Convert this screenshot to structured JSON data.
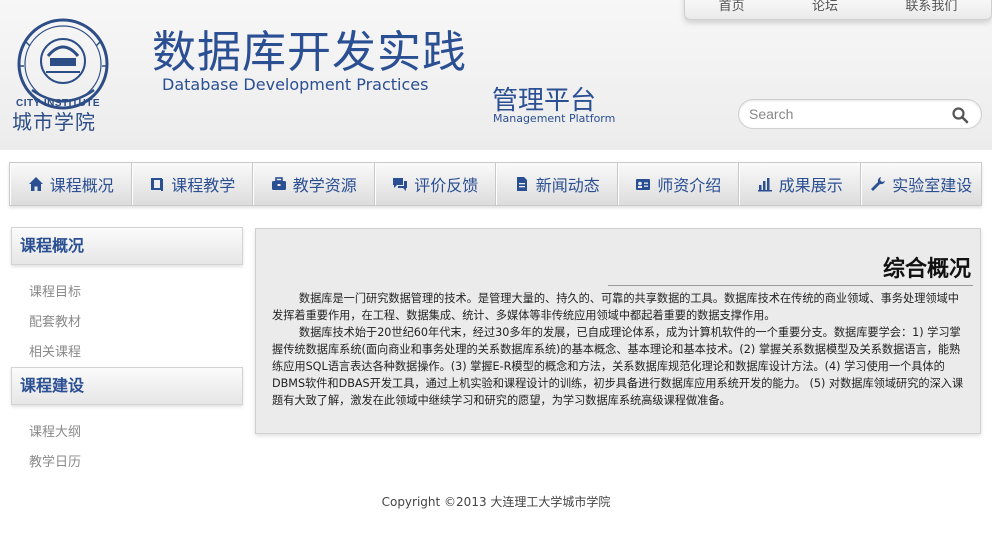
{
  "header": {
    "site_title": "数据库开发实践",
    "site_subtitle": "Database Development Practices",
    "platform_cn": "管理平台",
    "platform_en": "Management Platform",
    "logo_city": "CITY INSTITUTE",
    "logo_cn": "城市学院",
    "top_links": [
      "首页",
      "论坛",
      "联系我们"
    ],
    "search_placeholder": "Search"
  },
  "nav": [
    {
      "label": "课程概况",
      "icon": "home-icon"
    },
    {
      "label": "课程教学",
      "icon": "book-icon"
    },
    {
      "label": "教学资源",
      "icon": "briefcase-icon"
    },
    {
      "label": "评价反馈",
      "icon": "comments-icon"
    },
    {
      "label": "新闻动态",
      "icon": "document-icon"
    },
    {
      "label": "师资介绍",
      "icon": "id-card-icon"
    },
    {
      "label": "成果展示",
      "icon": "bar-chart-icon"
    },
    {
      "label": "实验室建设",
      "icon": "wrench-icon"
    }
  ],
  "sidebar": {
    "sections": [
      {
        "title": "课程概况",
        "links": [
          "课程目标",
          "配套教材",
          "相关课程"
        ]
      },
      {
        "title": "课程建设",
        "links": [
          "课程大纲",
          "教学日历"
        ]
      }
    ]
  },
  "main": {
    "title": "综合概况",
    "paragraphs": [
      "数据库是一门研究数据管理的技术。是管理大量的、持久的、可靠的共享数据的工具。数据库技术在传统的商业领域、事务处理领域中发挥着重要作用，在工程、数据集成、统计、多媒体等非传统应用领域中都起着重要的数据支撑作用。",
      "数据库技术始于20世纪60年代末，经过30多年的发展，已自成理论体系，成为计算机软件的一个重要分支。数据库要学会：1) 学习掌握传统数据库系统(面向商业和事务处理的关系数据库系统)的基本概念、基本理论和基本技术。(2) 掌握关系数据模型及关系数据语言，能熟练应用SQL语言表达各种数据操作。(3) 掌握E-R模型的概念和方法，关系数据库规范化理论和数据库设计方法。(4) 学习使用一个具体的DBMS软件和DBAS开发工具，通过上机实验和课程设计的训练，初步具备进行数据库应用系统开发的能力。 (5) 对数据库领域研究的深入课题有大致了解，激发在此领域中继续学习和研究的愿望，为学习数据库系统高级课程做准备。"
    ]
  },
  "footer": {
    "copyright": "Copyright ©2013 大连理工大学城市学院"
  },
  "colors": {
    "brand_blue": "#2b4f93",
    "panel_bg": "#ebebeb"
  }
}
